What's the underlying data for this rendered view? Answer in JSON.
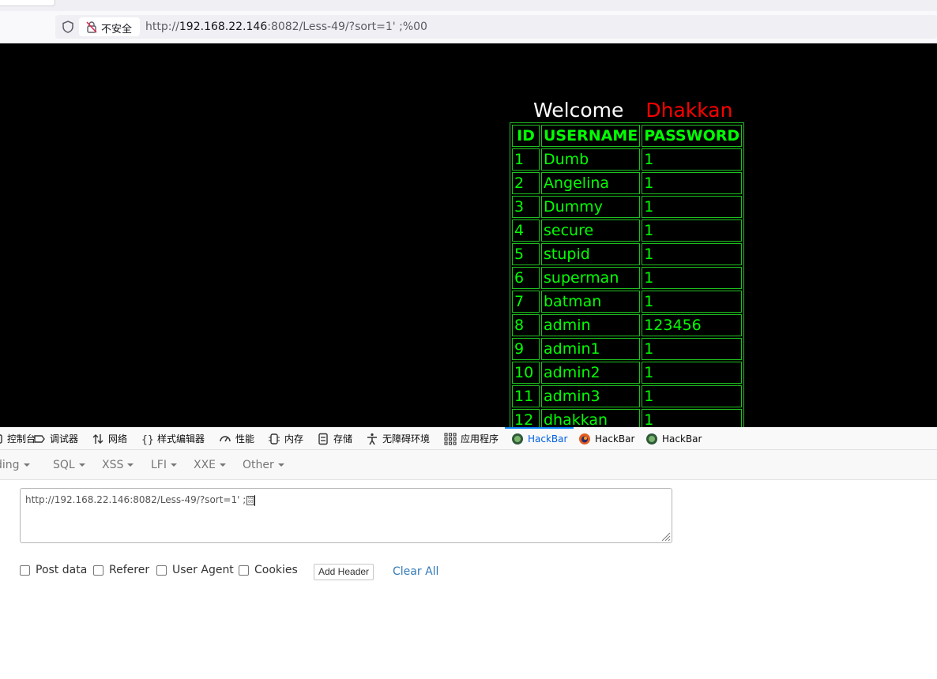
{
  "browser": {
    "security_label": "不安全",
    "url_prefix": "http://",
    "url_host": "192.168.22.146",
    "url_rest": ":8082/Less-49/?sort=1' ;%00"
  },
  "page": {
    "welcome": "Welcome",
    "name": "Dhakkan",
    "headers": [
      "ID",
      "USERNAME",
      "PASSWORD"
    ],
    "rows": [
      [
        "1",
        "Dumb",
        "1"
      ],
      [
        "2",
        "Angelina",
        "1"
      ],
      [
        "3",
        "Dummy",
        "1"
      ],
      [
        "4",
        "secure",
        "1"
      ],
      [
        "5",
        "stupid",
        "1"
      ],
      [
        "6",
        "superman",
        "1"
      ],
      [
        "7",
        "batman",
        "1"
      ],
      [
        "8",
        "admin",
        "123456"
      ],
      [
        "9",
        "admin1",
        "1"
      ],
      [
        "10",
        "admin2",
        "1"
      ],
      [
        "11",
        "admin3",
        "1"
      ],
      [
        "12",
        "dhakkan",
        "1"
      ]
    ],
    "colors": {
      "background": "#000000",
      "table_text": "#00ff00",
      "name": "#ff0000"
    }
  },
  "devtools": {
    "tabs": [
      {
        "label": "控制台",
        "icon": "console-icon"
      },
      {
        "label": "调试器",
        "icon": "debugger-icon"
      },
      {
        "label": "网络",
        "icon": "network-icon"
      },
      {
        "label": "样式编辑器",
        "icon": "style-editor-icon"
      },
      {
        "label": "性能",
        "icon": "performance-icon"
      },
      {
        "label": "内存",
        "icon": "memory-icon"
      },
      {
        "label": "存储",
        "icon": "storage-icon"
      },
      {
        "label": "无障碍环境",
        "icon": "accessibility-icon"
      },
      {
        "label": "应用程序",
        "icon": "application-icon"
      },
      {
        "label": "HackBar",
        "icon": "hackbar-icon",
        "active": true
      },
      {
        "label": "HackBar",
        "icon": "hackbar-firefox-icon"
      },
      {
        "label": "HackBar",
        "icon": "hackbar-icon"
      }
    ]
  },
  "hackbar": {
    "menu": [
      "Encoding",
      "SQL",
      "XSS",
      "LFI",
      "XXE",
      "Other"
    ],
    "url_value": "http://192.168.22.146:8082/Less-49/?sort=1' ;",
    "options": [
      "Post data",
      "Referer",
      "User Agent",
      "Cookies"
    ],
    "add_header": "Add Header",
    "clear_all": "Clear All"
  }
}
